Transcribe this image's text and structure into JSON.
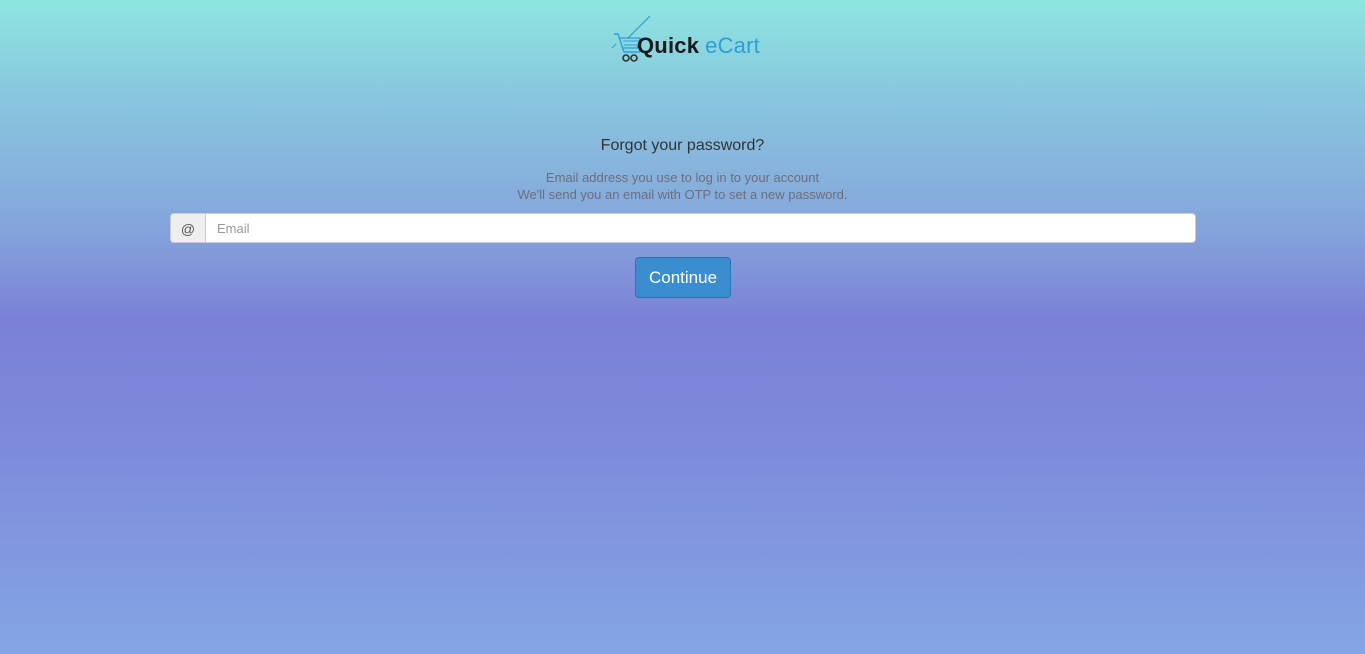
{
  "brand": {
    "name_part1": "Quick",
    "name_part2": "eCart",
    "accent_color": "#2b9fd8",
    "icon": "shopping-cart-icon"
  },
  "form": {
    "title": "Forgot your password?",
    "subtitle_line1": "Email address you use to log in to your account",
    "subtitle_line2": "We'll send you an email with OTP to set a new password.",
    "email_addon": "@",
    "email_placeholder": "Email",
    "email_value": "",
    "continue_label": "Continue",
    "button_color": "#3a8ed0"
  }
}
